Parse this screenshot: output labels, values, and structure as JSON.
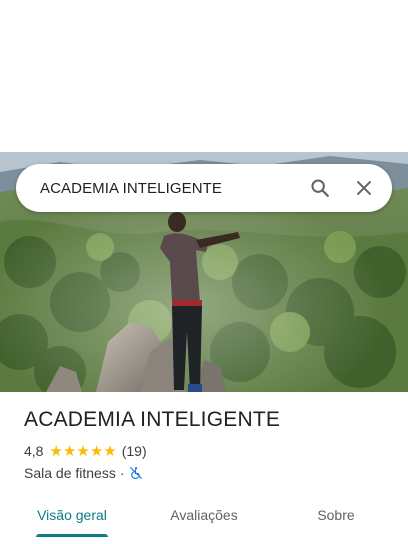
{
  "search": {
    "query": "ACADEMIA INTELIGENTE",
    "search_icon": "search-icon",
    "close_icon": "close-icon"
  },
  "place": {
    "name": "ACADEMIA INTELIGENTE",
    "rating": "4,8",
    "stars": 5,
    "review_count": "(19)",
    "category": "Sala de fitness",
    "separator": "·",
    "accessibility_icon": "wheelchair-crossed-icon"
  },
  "tabs": [
    {
      "label": "Visão geral",
      "active": true
    },
    {
      "label": "Avaliações",
      "active": false
    },
    {
      "label": "Sobre",
      "active": false
    }
  ],
  "colors": {
    "accent": "#0b7c86",
    "star": "#fbbc04",
    "accessibility": "#1a73e8"
  }
}
